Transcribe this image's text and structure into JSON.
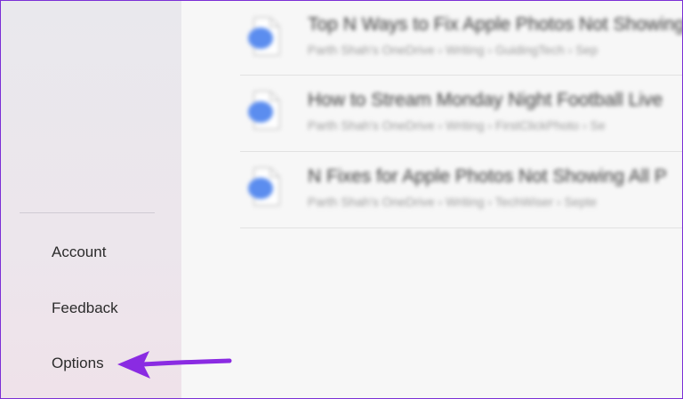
{
  "sidebar": {
    "items": [
      {
        "label": "Account"
      },
      {
        "label": "Feedback"
      },
      {
        "label": "Options"
      }
    ]
  },
  "files": [
    {
      "title": "Top N Ways to Fix Apple Photos Not Showing",
      "path": "Parth Shah's OneDrive › Writing › GuidingTech › Sep"
    },
    {
      "title": "How to Stream Monday Night Football Live",
      "path": "Parth Shah's OneDrive › Writing › FirstClickPhoto › Se"
    },
    {
      "title": "N Fixes for Apple Photos Not Showing All P",
      "path": "Parth Shah's OneDrive › Writing › TechWiser › Septe"
    }
  ],
  "colors": {
    "annotation_arrow": "#8a2be2",
    "frame_border": "#7b2fd6",
    "doc_icon_accent": "#5b8def"
  },
  "icons": {
    "file": "word-document-icon",
    "annotation": "arrow-pointer-icon"
  }
}
